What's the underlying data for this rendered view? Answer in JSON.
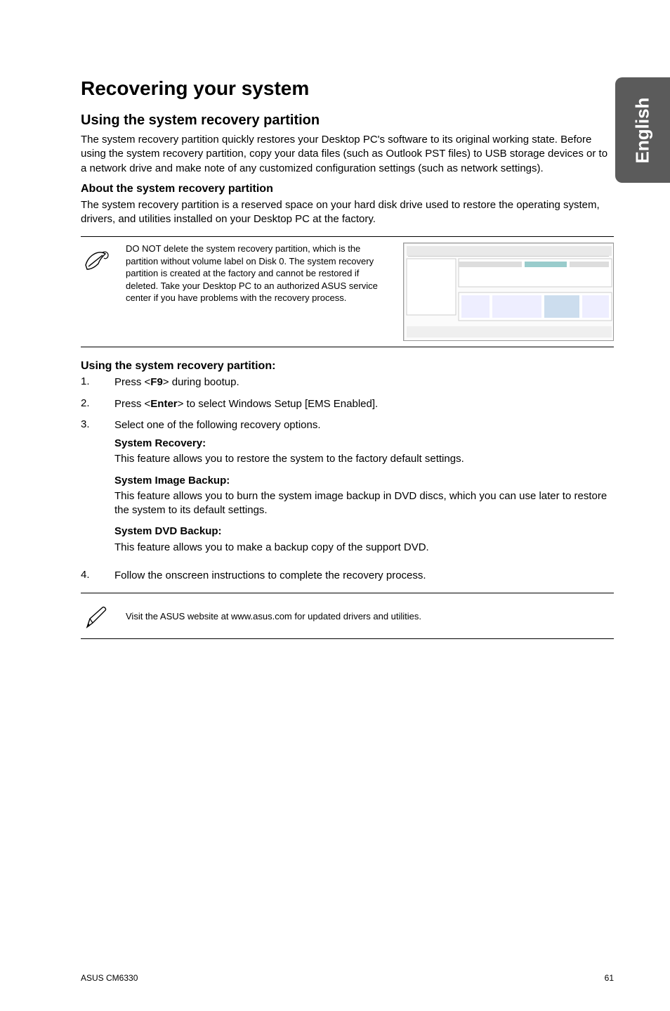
{
  "sideTab": "English",
  "title": "Recovering your system",
  "section1": {
    "heading": "Using the system recovery partition",
    "intro": "The system recovery partition quickly restores your Desktop PC's software to its original working state. Before using the system recovery partition, copy your data files (such as Outlook PST files) to USB storage devices or to a network drive and make note of any customized configuration settings (such as network settings).",
    "about_heading": "About the system recovery partition",
    "about_text": "The system recovery partition is a reserved space on your hard disk drive used to restore the operating system, drivers, and utilities installed on your Desktop PC at the factory.",
    "warning": "DO NOT delete the system recovery partition, which is the partition without volume label on Disk 0. The system recovery partition is created at the factory and cannot be restored if deleted. Take your Desktop PC to an authorized ASUS service center if you have problems with the recovery process."
  },
  "usage": {
    "heading": "Using the system recovery partition:",
    "steps": [
      {
        "n": "1.",
        "text_before": "Press <",
        "key": "F9",
        "text_after": "> during bootup."
      },
      {
        "n": "2.",
        "text_before": "Press <",
        "key": "Enter",
        "text_after": "> to select Windows Setup [EMS Enabled]."
      },
      {
        "n": "3.",
        "text_before": "Select one of the following recovery options.",
        "key": "",
        "text_after": ""
      }
    ],
    "subs": [
      {
        "title": "System Recovery:",
        "text": "This feature allows you to restore the system to the factory default settings."
      },
      {
        "title": "System Image Backup:",
        "text": "This feature allows you to burn the system image backup in DVD discs, which you can use later to restore the system to its default settings."
      },
      {
        "title": "System DVD Backup:",
        "text": "This feature allows you to make a backup copy of the support DVD."
      }
    ],
    "step4": {
      "n": "4.",
      "text": "Follow the onscreen instructions to complete the recovery process."
    }
  },
  "tip": "Visit the ASUS website at www.asus.com for updated drivers and utilities.",
  "footer": {
    "left": "ASUS CM6330",
    "right": "61"
  }
}
